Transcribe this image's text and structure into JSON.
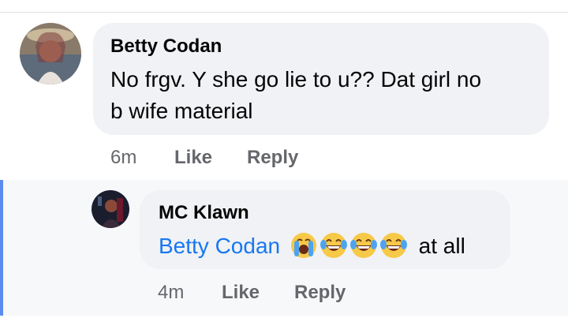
{
  "comments": [
    {
      "author": "Betty Codan",
      "text_line1": "No frgv. Y she go lie to u?? Dat girl no",
      "text_line2": "b wife material",
      "time": "6m",
      "like_label": "Like",
      "reply_label": "Reply"
    }
  ],
  "reply": {
    "author": "MC Klawn",
    "mention": "Betty Codan",
    "emojis": [
      "loudly-crying-face",
      "face-with-tears-of-joy",
      "face-with-tears-of-joy",
      "face-with-tears-of-joy"
    ],
    "text_suffix": "at all",
    "time": "4m",
    "like_label": "Like",
    "reply_label": "Reply"
  },
  "colors": {
    "bubble": "#f0f2f5",
    "mention": "#1877f2",
    "meta": "#65676b",
    "thread_line": "#5b8def"
  }
}
